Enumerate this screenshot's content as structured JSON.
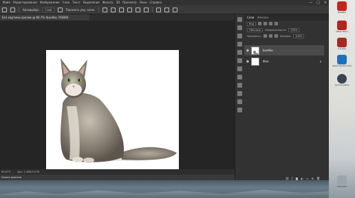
{
  "menubar": {
    "items": [
      "Файл",
      "Редактирование",
      "Изображение",
      "Слои",
      "Текст",
      "Выделение",
      "Фильтр",
      "3D",
      "Просмотр",
      "Окно",
      "Справка"
    ],
    "window_controls": [
      "—",
      "□",
      "✕"
    ]
  },
  "options_bar": {
    "autoselect_label": "Автовыбор:",
    "autoselect_value": "Слой",
    "transform_label": "Показать упр. элем."
  },
  "document": {
    "tab_title": "Без картины кролик @ 66,7% (buehko, RGB/8)",
    "zoom": "66,67%",
    "doc_info": "Док: 2,36M/3,07M"
  },
  "timeline": {
    "label": "Шкала времени"
  },
  "layers_panel": {
    "tabs": [
      "Слои",
      "Каналы"
    ],
    "kind_label": "Вид",
    "blend_mode": "Обычные",
    "opacity_label": "Непрозрачность:",
    "opacity_value": "100%",
    "lock_label": "Закрепить:",
    "fill_label": "Заливка:",
    "fill_value": "100%",
    "layers": [
      {
        "name": "buehko"
      },
      {
        "name": "Фон"
      }
    ]
  },
  "desktop": {
    "icons": [
      {
        "label": "Hexafire",
        "color": "#c4241a"
      },
      {
        "label": "Oledo Films",
        "color": "#b0261d"
      },
      {
        "label": "1-0 мин",
        "color": "#a52a22"
      },
      {
        "label": "Visual Studio Code",
        "color": "#1f6fbf"
      },
      {
        "label": "Lacuna Aloha",
        "color": "#3a4450"
      },
      {
        "label": "Корзина",
        "color": "#9aa4ad"
      }
    ]
  }
}
